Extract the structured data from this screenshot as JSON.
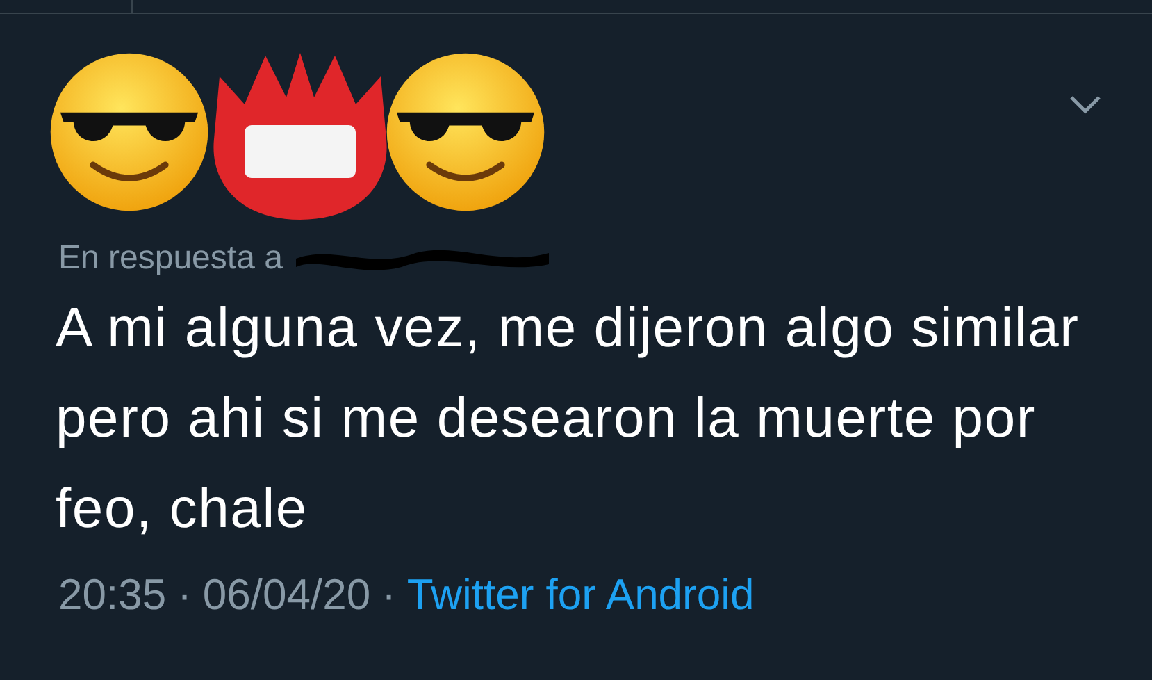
{
  "reply": {
    "label": "En respuesta a"
  },
  "tweet": {
    "text": "A mi alguna vez, me dijeron algo similar pero ahi si me desearon la muerte por feo, chale"
  },
  "footer": {
    "time": "20:35",
    "separator_1": "·",
    "date": "06/04/20",
    "separator_2": "·",
    "source": "Twitter for Android"
  }
}
